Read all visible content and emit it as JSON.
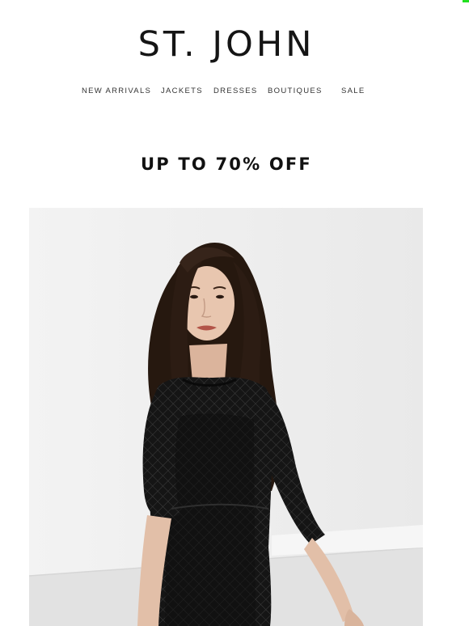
{
  "brand": {
    "name": "ST. JOHN"
  },
  "nav": {
    "items": [
      {
        "label": "NEW ARRIVALS"
      },
      {
        "label": "JACKETS"
      },
      {
        "label": "DRESSES"
      },
      {
        "label": "BOUTIQUES"
      },
      {
        "label": "SALE"
      }
    ]
  },
  "promo": {
    "heading": "UP TO 70% OFF"
  },
  "hero": {
    "image": "model-in-black-mesh-dress-photo"
  },
  "colors": {
    "background": "#ffffff",
    "text": "#151515",
    "hero_backdrop": "#ececec",
    "dress": "#141414",
    "hair": "#2a1c15",
    "skin": "#e6c2ab",
    "corner_mark": "#22e01f"
  }
}
